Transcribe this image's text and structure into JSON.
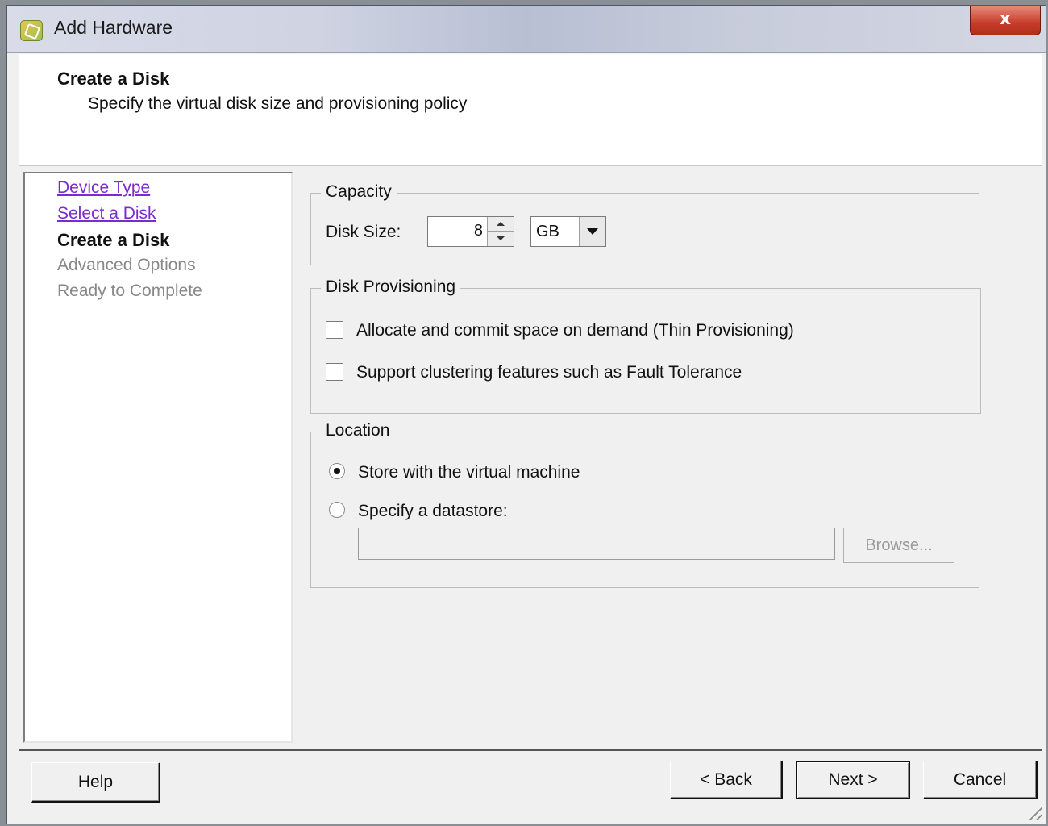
{
  "window": {
    "title": "Add Hardware",
    "close_label": "x"
  },
  "header": {
    "title": "Create a Disk",
    "subtitle": "Specify the virtual disk size and provisioning policy"
  },
  "steps": [
    {
      "label": "Device Type",
      "state": "visited"
    },
    {
      "label": "Select a Disk",
      "state": "visited"
    },
    {
      "label": "Create a Disk",
      "state": "current"
    },
    {
      "label": "Advanced Options",
      "state": "future"
    },
    {
      "label": "Ready to Complete",
      "state": "future"
    }
  ],
  "capacity": {
    "legend": "Capacity",
    "disk_size_label": "Disk Size:",
    "disk_size_value": "8",
    "unit_value": "GB"
  },
  "provisioning": {
    "legend": "Disk Provisioning",
    "thin": {
      "label": "Allocate and commit space on demand (Thin Provisioning)",
      "checked": false
    },
    "clustering": {
      "label": "Support clustering features such as Fault Tolerance",
      "checked": false
    }
  },
  "location": {
    "legend": "Location",
    "store_with_vm": {
      "label": "Store with the virtual machine",
      "selected": true
    },
    "specify_datastore": {
      "label": "Specify a datastore:",
      "selected": false
    },
    "datastore_value": "",
    "browse_label": "Browse..."
  },
  "footer": {
    "help_label": "Help",
    "back_label": "< Back",
    "next_label": "Next >",
    "cancel_label": "Cancel"
  },
  "colors": {
    "link_visited": "#7a2ccf",
    "close_red": "#c63d2a",
    "disabled_text": "#888888"
  }
}
